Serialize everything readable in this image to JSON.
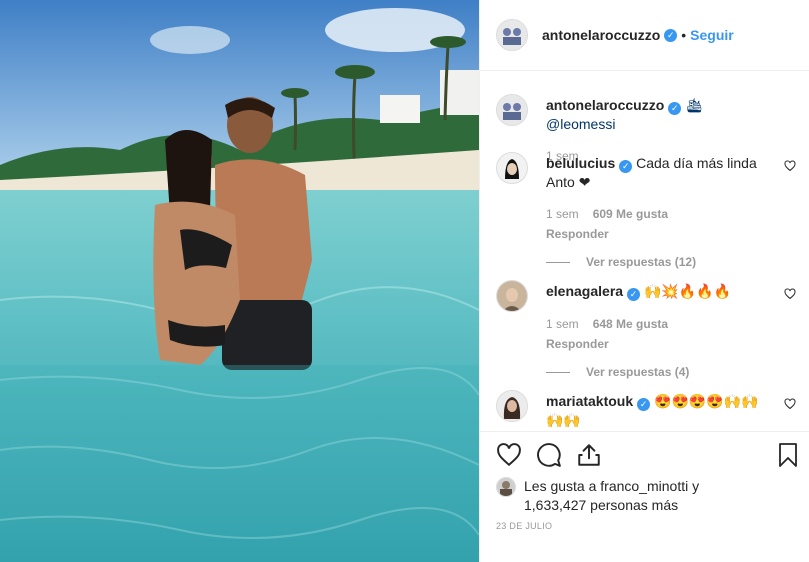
{
  "header": {
    "username": "antonelaroccuzzo",
    "dot": "•",
    "follow_label": "Seguir"
  },
  "caption": {
    "username": "antonelaroccuzzo",
    "text": "🛳 @leomessi",
    "time": "1 sem"
  },
  "comments": [
    {
      "username": "belulucius",
      "text": "Cada día más linda Anto ❤",
      "time": "1 sem",
      "likes": "609 Me gusta",
      "reply_label": "Responder",
      "view_replies": "Ver respuestas (12)"
    },
    {
      "username": "elenagalera",
      "text": "🙌💥🔥🔥🔥",
      "time": "1 sem",
      "likes": "648 Me gusta",
      "reply_label": "Responder",
      "view_replies": "Ver respuestas (4)"
    },
    {
      "username": "mariataktouk",
      "text": "😍😍😍😍🙌🙌🙌🙌"
    }
  ],
  "likes": {
    "line1": "Les gusta a franco_minotti y",
    "line2": "1,633,427 personas más"
  },
  "date": "23 DE JULIO",
  "icons": [
    "verified-badge",
    "heart-icon",
    "comment-icon",
    "share-icon",
    "bookmark-icon"
  ],
  "colors": {
    "link": "#3897f0",
    "muted": "#999999",
    "border": "#efefef",
    "red_heart": "#ed4956"
  }
}
